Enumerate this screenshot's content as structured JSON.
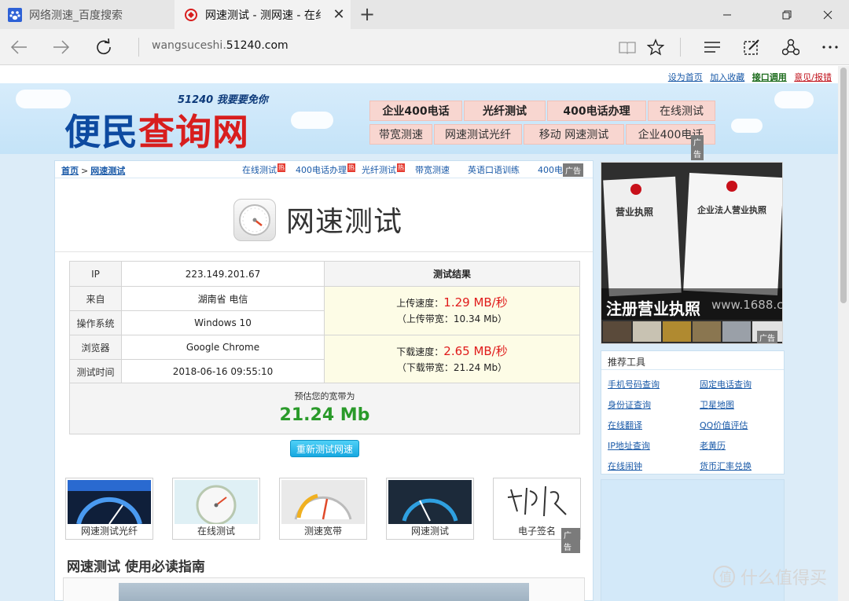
{
  "browser": {
    "tabs": [
      {
        "title": "网络测速_百度搜索",
        "icon": "baidu-paw-icon"
      },
      {
        "title": "网速测试 - 测网速 - 在纟",
        "icon": "site-icon"
      }
    ],
    "address": {
      "prefix": "wangsuceshi.",
      "domain": "51240.com"
    }
  },
  "site": {
    "toplinks": [
      "设为首页",
      "加入收藏",
      "接口调用",
      "意见/报错"
    ],
    "slogan": "51240 我要要免你",
    "brand_a": "便民",
    "brand_b": "查询网",
    "topnav": [
      "企业400电话",
      "光纤测试",
      "400电话办理",
      "在线测试",
      "带宽测速",
      "网速测试光纤",
      "移动 网速测试",
      "企业400电话"
    ],
    "ad_label": "广告"
  },
  "main": {
    "crumb_home": "首页",
    "crumb_sep": ">",
    "crumb_current": "网速测试",
    "sublinks": [
      {
        "label": "在线测试",
        "hot": "热"
      },
      {
        "label": "400电话办理",
        "hot": "热"
      },
      {
        "label": "光纤测试",
        "hot": "热"
      },
      {
        "label": "带宽测速",
        "hot": ""
      },
      {
        "label": "英语口语训练",
        "hot": ""
      },
      {
        "label": "400电话",
        "hot": ""
      }
    ],
    "page_title": "网速测试",
    "table": {
      "ip_label": "IP",
      "ip": "223.149.201.67",
      "from_label": "来自",
      "from": "湖南省 电信",
      "os_label": "操作系统",
      "os": "Windows 10",
      "browser_label": "浏览器",
      "browser": "Google Chrome",
      "time_label": "测试时间",
      "time": "2018-06-16 09:55:10",
      "result_head": "测试结果",
      "upload_label": "上传速度：",
      "upload_speed": "1.29 MB/秒",
      "upload_bw": "（上传带宽：10.34 Mb）",
      "download_label": "下载速度：",
      "download_speed": "2.65 MB/秒",
      "download_bw": "（下载带宽：21.24 Mb）"
    },
    "estimate_label": "预估您的宽带为",
    "estimate_value": "21.24 Mb",
    "retest_button": "重新测试网速",
    "thumbs": [
      "网速测试光纤",
      "在线测试",
      "测速宽带",
      "网速测试",
      "电子签名"
    ],
    "guide_title": "网速测试 使用必读指南"
  },
  "sidebar": {
    "ad_caption": "注册营业执照",
    "ad_watermark": "www.1688.co",
    "cert_left": "营业执照",
    "cert_right": "企业法人营业执照",
    "tools_title": "推荐工具",
    "tools": [
      "手机号码查询",
      "固定电话查询",
      "身份证查询",
      "卫星地图",
      "在线翻译",
      "QQ价值评估",
      "IP地址查询",
      "老黄历",
      "在线闹钟",
      "货币汇率兑换"
    ]
  },
  "watermark": "什么值得买",
  "colors": {
    "accent_blue": "#1a5aa8",
    "speed_red": "#e01b1b",
    "estimate_green": "#2a9a2a",
    "nav_pink": "#f8d6d0"
  }
}
